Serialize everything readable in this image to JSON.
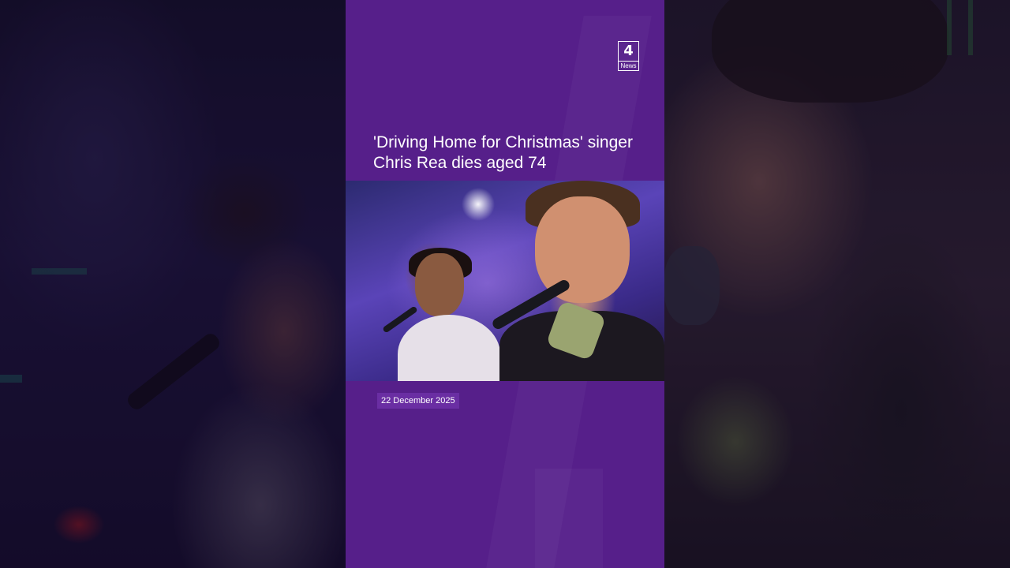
{
  "video": {
    "headline": "'Driving Home for Christmas' singer Chris Rea dies aged 74",
    "date": "22 December 2025"
  },
  "brand": {
    "logo_text": "4",
    "logo_label": "News",
    "background_color": "#561f8a",
    "text_color": "#ffffff"
  }
}
